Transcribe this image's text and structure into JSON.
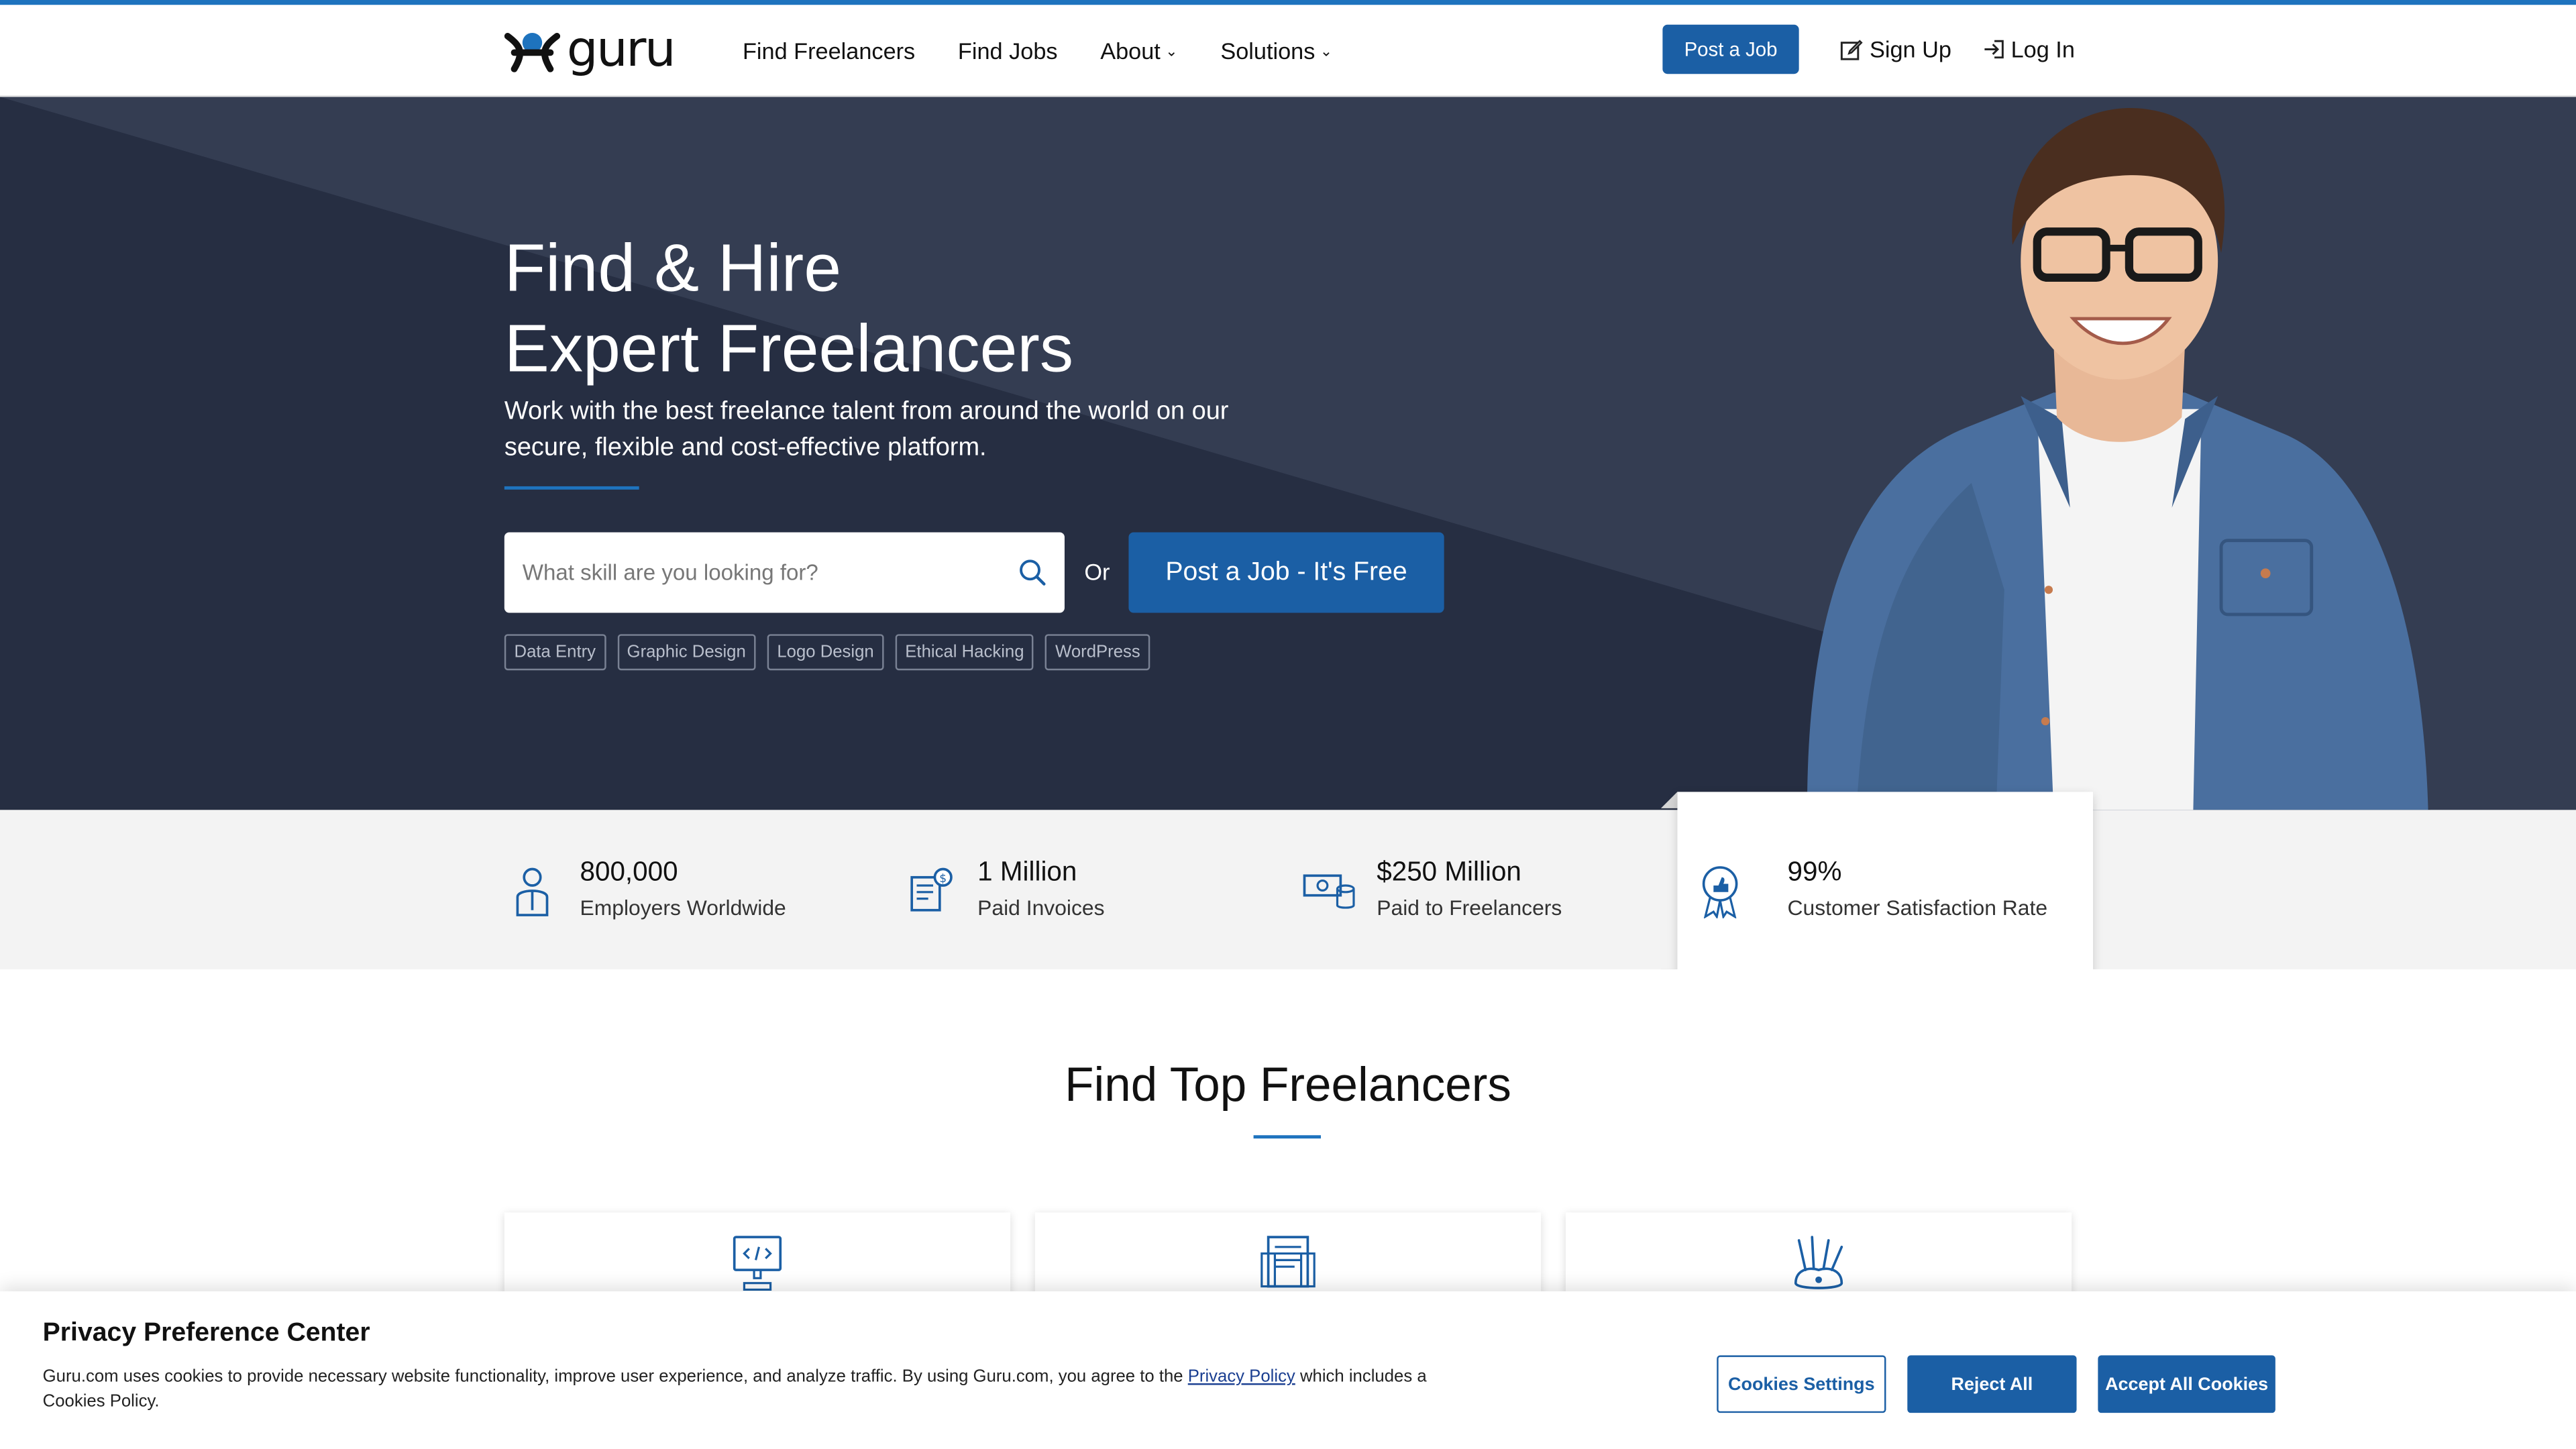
{
  "brand": {
    "logo_text": "guru",
    "accent": "#1b5fa5",
    "hero_bg": "#2b3448"
  },
  "nav": {
    "items": [
      {
        "label": "Find Freelancers"
      },
      {
        "label": "Find Jobs"
      },
      {
        "label": "About",
        "icon": "chevron-down-icon"
      },
      {
        "label": "Solutions",
        "icon": "chevron-down-icon"
      }
    ],
    "post_job": "Post a Job",
    "sign_up": "Sign Up",
    "log_in": "Log In"
  },
  "hero": {
    "title_line1": "Find & Hire",
    "title_line2": "Expert Freelancers",
    "subtitle": "Work with the best freelance talent from around the world on our secure, flexible and cost-effective platform.",
    "search_placeholder": "What skill are you looking for?",
    "or": "Or",
    "cta": "Post a Job - It's Free",
    "tags": [
      "Data Entry",
      "Graphic Design",
      "Logo Design",
      "Ethical Hacking",
      "WordPress"
    ]
  },
  "stats": [
    {
      "value": "800,000",
      "label": "Employers Worldwide",
      "icon": "employer-icon"
    },
    {
      "value": "1 Million",
      "label": "Paid Invoices",
      "icon": "invoice-icon"
    },
    {
      "value": "$250 Million",
      "label": "Paid to Freelancers",
      "icon": "money-icon"
    },
    {
      "value": "99%",
      "label": "Customer Satisfaction Rate",
      "icon": "award-badge-icon"
    }
  ],
  "find_top": {
    "title": "Find Top Freelancers"
  },
  "categories": [
    {
      "icon": "code-monitor-icon"
    },
    {
      "icon": "document-writing-icon"
    },
    {
      "icon": "design-tools-icon"
    }
  ],
  "cookie": {
    "title": "Privacy Preference Center",
    "text_before": "Guru.com uses cookies to provide necessary website functionality, improve user experience, and analyze traffic. By using Guru.com, you agree to the ",
    "link": "Privacy Policy",
    "text_after": " which includes a Cookies Policy.",
    "settings": "Cookies Settings",
    "reject": "Reject All",
    "accept": "Accept All Cookies"
  }
}
